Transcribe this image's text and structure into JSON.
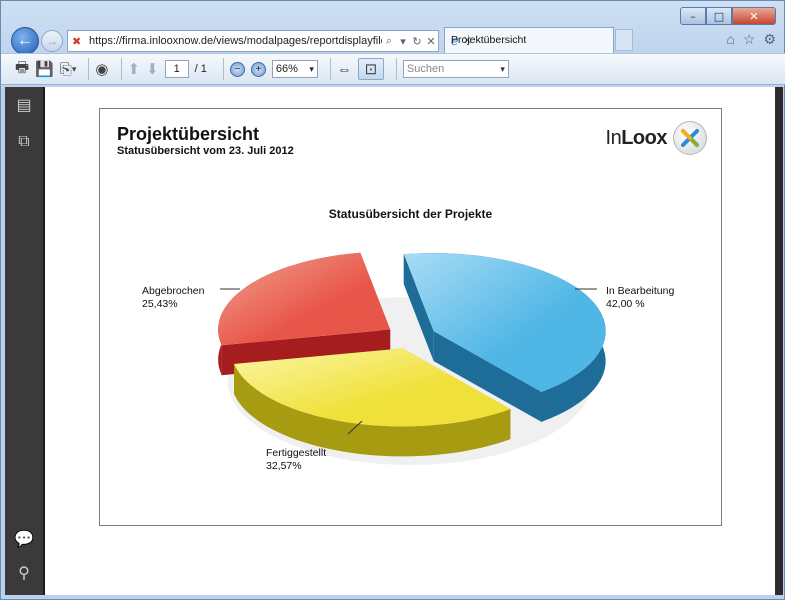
{
  "browser": {
    "url": "https://firma.inlooxnow.de/views/modalpages/reportdisplayfile",
    "tab_title": "Projektübersicht",
    "window_controls": [
      "–",
      "□",
      "✕"
    ]
  },
  "pdf_toolbar": {
    "page_current": "1",
    "page_total": "/ 1",
    "zoom": "66%",
    "search_placeholder": "Suchen"
  },
  "report": {
    "title": "Projektübersicht",
    "subtitle": "Statusübersicht vom 23. Juli 2012",
    "logo_text_light": "In",
    "logo_text_bold": "Loox"
  },
  "chart_data": {
    "type": "pie",
    "title": "Statusübersicht der Projekte",
    "categories": [
      "In Bearbeitung",
      "Fertiggestellt",
      "Abgebrochen"
    ],
    "values": [
      42.0,
      32.57,
      25.43
    ],
    "value_labels": [
      "42,00 %",
      "32,57%",
      "25,43%"
    ],
    "colors": [
      "#4fb6e6",
      "#f0e13a",
      "#e8564a"
    ],
    "exploded": true,
    "three_d": true
  }
}
